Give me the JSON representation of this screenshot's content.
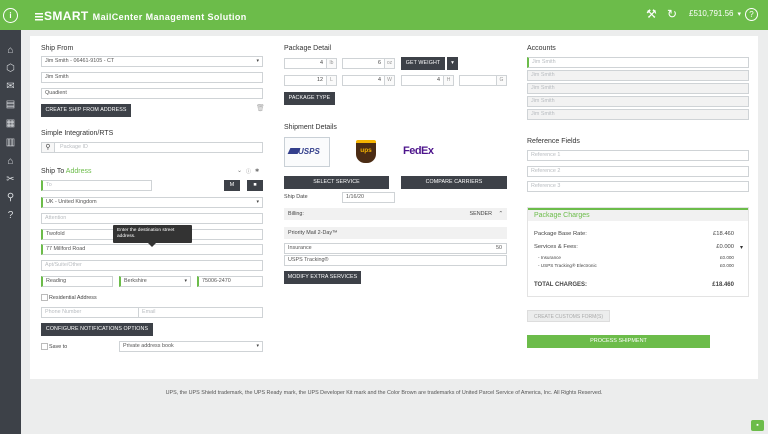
{
  "app": {
    "brand_strong": "SMART",
    "brand_title": "MailCenter Management Solution",
    "balance": "£510,791.56",
    "balance_chevron": "▾"
  },
  "icons": {
    "info": "i",
    "tools": "⚒",
    "refresh": "↻",
    "help": "?",
    "rail": [
      "⌂",
      "⬡",
      "✉",
      "▤",
      "▦",
      "▥",
      "⌂",
      "✂",
      "⚲",
      "?"
    ]
  },
  "ship_from": {
    "title": "Ship From",
    "account_select": "Jim Smith - 06461-9105 - CT",
    "name": "Jim Smith",
    "company": "Quadient",
    "create_button": "CREATE SHIP FROM ADDRESS",
    "trash_icon": "🗑"
  },
  "integration": {
    "title": "Simple Integration/RTS",
    "package_id_placeholder": "Package ID",
    "search_icon": "⚲"
  },
  "ship_to": {
    "title_prefix": "Ship To",
    "title_suffix": "Address",
    "to_placeholder": "To",
    "btn_m": "M",
    "btn_save": "■",
    "country": "UK - United Kingdom",
    "attention_placeholder": "Attention",
    "company": "Twofold",
    "street": "77 Millford Road",
    "street2_placeholder": "Apt/Suite/Other",
    "city": "Reading",
    "county": "Berkshire",
    "postcode": "75006-2470",
    "residential_label": "Residential Address",
    "phone_placeholder": "Phone Number",
    "email_placeholder": "Email",
    "notifications_button": "CONFIGURE NOTIFICATIONS OPTIONS",
    "save_to_label": "Save to",
    "address_book": "Private address book",
    "tooltip": "Enter the destination street address."
  },
  "package_detail": {
    "title": "Package Detail",
    "lb_value": "4",
    "lb_unit": "lb",
    "oz_value": "6",
    "oz_unit": "oz",
    "get_weight_button": "GET WEIGHT",
    "length_value": "12",
    "length_unit": "L",
    "width_value": "4",
    "width_unit": "W",
    "height_value": "4",
    "height_unit": "H",
    "girth_unit": "G",
    "package_type_button": "PACKAGE TYPE"
  },
  "shipment_details": {
    "title": "Shipment Details",
    "carriers": [
      "USPS",
      "UPS",
      "FedEx"
    ],
    "select_service_button": "SELECT SERVICE",
    "compare_carriers_button": "COMPARE CARRIERS",
    "ship_date_label": "Ship Date",
    "ship_date": "1/16/20",
    "billing_label": "Billing:",
    "billing_value": "SENDER",
    "service": "Priority Mail 2-Day™",
    "insurance_label": "Insurance",
    "insurance_value": "50",
    "tracking": "USPS Tracking®",
    "modify_button": "MODIFY EXTRA SERVICES"
  },
  "accounts": {
    "title": "Accounts",
    "items": [
      "Jim Smith",
      "Jim Smith",
      "Jim Smith",
      "Jim Smith",
      "Jim Smith"
    ]
  },
  "reference": {
    "title": "Reference Fields",
    "placeholders": [
      "Reference 1",
      "Reference 2",
      "Reference 3"
    ]
  },
  "charges": {
    "title": "Package Charges",
    "base_rate_label": "Package Base Rate:",
    "base_rate": "£18.460",
    "fees_label": "Services & Fees:",
    "fees": "£0.000",
    "insurance_label": "- Insurance",
    "insurance": "£0.000",
    "tracking_label": "- USPS Tracking® Electronic",
    "tracking": "£0.000",
    "total_label": "TOTAL CHARGES:",
    "total": "£18.460"
  },
  "actions": {
    "customs_button": "CREATE CUSTOMS FORM(S)",
    "process_button": "PROCESS SHIPMENT"
  },
  "footer": {
    "text": "UPS, the UPS Shield trademark, the UPS Ready mark, the UPS Developer Kit mark and the Color Brown are trademarks of United Parcel Service of America, Inc. All Rights Reserved."
  },
  "colors": {
    "brand_green": "#6cbc4a",
    "rail_dark": "#3d4148",
    "button_dark": "#3d4148",
    "ups_brown": "#4b2c14",
    "fedex_purple": "#4d148c",
    "fedex_orange": "#ff6600",
    "usps_blue": "#333f8c"
  }
}
